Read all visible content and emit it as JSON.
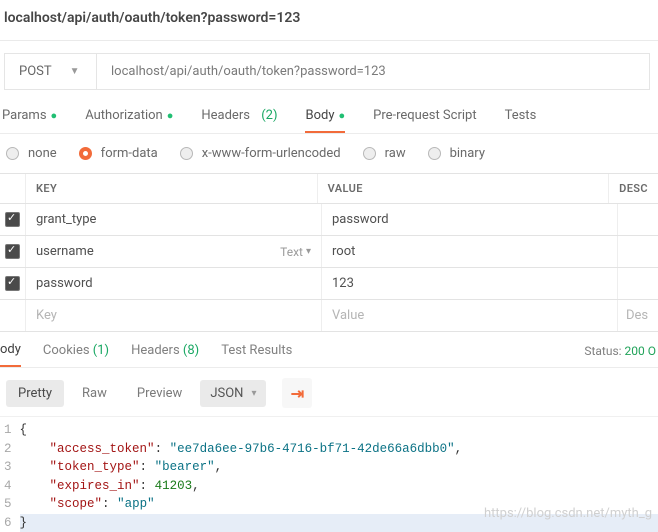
{
  "top_url": "localhost/api/auth/oauth/token?password=123",
  "method": "POST",
  "request_url": "localhost/api/auth/oauth/token?password=123",
  "tabs": {
    "params": "Params",
    "authorization": "Authorization",
    "headers_label": "Headers",
    "headers_count": "(2)",
    "body": "Body",
    "pre_request": "Pre-request Script",
    "tests": "Tests"
  },
  "body_types": {
    "none": "none",
    "form_data": "form-data",
    "urlencoded": "x-www-form-urlencoded",
    "raw": "raw",
    "binary": "binary"
  },
  "kv": {
    "hdr_key": "KEY",
    "hdr_value": "VALUE",
    "hdr_desc": "DESC",
    "rows": [
      {
        "key": "grant_type",
        "value": "password",
        "type": ""
      },
      {
        "key": "username",
        "value": "root",
        "type": "Text"
      },
      {
        "key": "password",
        "value": "123",
        "type": ""
      }
    ],
    "ph_key": "Key",
    "ph_value": "Value",
    "ph_desc": "Des"
  },
  "response": {
    "tabs": {
      "body": "ody",
      "cookies": "Cookies",
      "cookies_count": "(1)",
      "headers": "Headers",
      "headers_count": "(8)",
      "test_results": "Test Results"
    },
    "status_label": "Status:",
    "status_value": "200 O",
    "viewer": {
      "pretty": "Pretty",
      "raw": "Raw",
      "preview": "Preview",
      "format": "JSON"
    },
    "json": {
      "access_token": "ee7da6ee-97b6-4716-bf71-42de66a6dbb0",
      "token_type": "bearer",
      "expires_in": 41203,
      "scope": "app"
    }
  },
  "watermark": "https://blog.csdn.net/myth_g"
}
